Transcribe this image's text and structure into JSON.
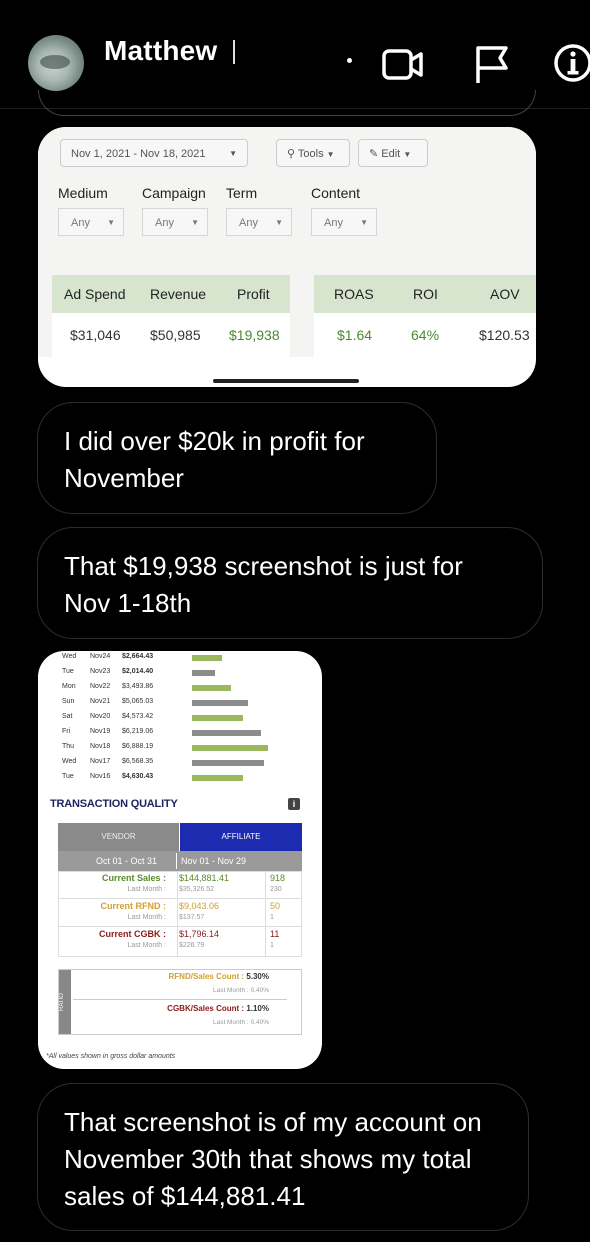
{
  "header": {
    "contact_name": "Matthew",
    "icons": [
      "video-call-icon",
      "flag-icon",
      "info-icon"
    ]
  },
  "card1": {
    "date_range": "Nov 1, 2021 - Nov 18, 2021",
    "tools_label": "Tools",
    "edit_label": "Edit",
    "filters": [
      {
        "label": "Medium",
        "value": "Any"
      },
      {
        "label": "Campaign",
        "value": "Any"
      },
      {
        "label": "Term",
        "value": "Any"
      },
      {
        "label": "Content",
        "value": "Any"
      }
    ],
    "metrics": [
      {
        "label": "Ad Spend",
        "value": "$31,046"
      },
      {
        "label": "Revenue",
        "value": "$50,985"
      },
      {
        "label": "Profit",
        "value": "$19,938"
      },
      {
        "label": "ROAS",
        "value": "$1.64"
      },
      {
        "label": "ROI",
        "value": "64%"
      },
      {
        "label": "AOV",
        "value": "$120.53"
      }
    ]
  },
  "messages": [
    "I did over $20k in profit for November",
    "That $19,938 screenshot is just for Nov 1-18th",
    "That screenshot is of my account on November 30th that shows my total sales of $144,881.41"
  ],
  "card2": {
    "daily": [
      {
        "day": "Wed",
        "date": "Nov24",
        "amount": "$2,664.43",
        "fraction": 0.4
      },
      {
        "day": "Tue",
        "date": "Nov23",
        "amount": "$2,014.40",
        "fraction": 0.3
      },
      {
        "day": "Mon",
        "date": "Nov22",
        "amount": "$3,493.86",
        "fraction": 0.51
      },
      {
        "day": "Sun",
        "date": "Nov21",
        "amount": "$5,065.03",
        "fraction": 0.74
      },
      {
        "day": "Sat",
        "date": "Nov20",
        "amount": "$4,573.42",
        "fraction": 0.67
      },
      {
        "day": "Fri",
        "date": "Nov19",
        "amount": "$6,219.06",
        "fraction": 0.91
      },
      {
        "day": "Thu",
        "date": "Nov18",
        "amount": "$6,888.19",
        "fraction": 1.0
      },
      {
        "day": "Wed",
        "date": "Nov17",
        "amount": "$6,568.35",
        "fraction": 0.95
      },
      {
        "day": "Tue",
        "date": "Nov16",
        "amount": "$4,630.43",
        "fraction": 0.67
      }
    ],
    "bar_colors": [
      "#9cb85f",
      "#8c8c8c"
    ],
    "section_title": "TRANSACTION QUALITY",
    "tab_vendor": "VENDOR",
    "tab_affiliate": "AFFILIATE",
    "period_left": "Oct 01 - Oct 31",
    "period_right": "Nov 01 - Nov 29",
    "rows": [
      {
        "label": "Current Sales :",
        "value": "$144,881.41",
        "count": "918",
        "last_label": "Last Month :",
        "last_value": "$35,326.52",
        "last_count": "230",
        "color": "#5a8a2a"
      },
      {
        "label": "Current RFND :",
        "value": "$9,043.06",
        "count": "50",
        "last_label": "Last Month :",
        "last_value": "$137.57",
        "last_count": "1",
        "color": "#d2a030"
      },
      {
        "label": "Current CGBK :",
        "value": "$1,796.14",
        "count": "11",
        "last_label": "Last Month :",
        "last_value": "$226.79",
        "last_count": "1",
        "color": "#8a1a1a"
      }
    ],
    "ratio_label": "RATIO",
    "ratios": [
      {
        "label": "RFND/Sales Count :",
        "value": "5.30%",
        "last_label": "Last Month :",
        "last_value": "0.40%",
        "color": "#d2a030"
      },
      {
        "label": "CGBK/Sales Count :",
        "value": "1.10%",
        "last_label": "Last Month :",
        "last_value": "0.40%",
        "color": "#8a1a1a"
      }
    ],
    "footnote": "*All values shown in gross dollar amounts"
  }
}
